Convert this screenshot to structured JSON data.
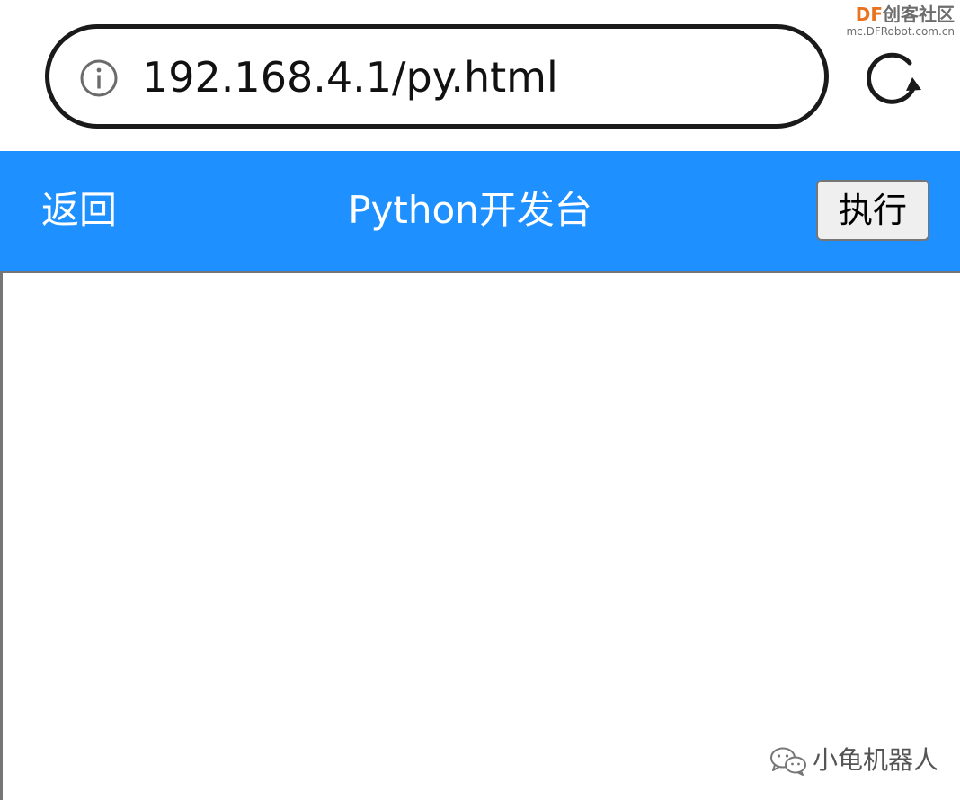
{
  "browser": {
    "url": "192.168.4.1/py.html",
    "info_icon": "info-icon",
    "reload_icon": "reload-icon"
  },
  "watermark_top": {
    "brand_df": "DF",
    "brand_cn": "创客社区",
    "site": "mc.DFRobot.com.cn"
  },
  "header": {
    "back_label": "返回",
    "title": "Python开发台",
    "run_label": "执行",
    "color": "#1e90ff"
  },
  "editor": {
    "value": ""
  },
  "watermark_bottom": {
    "icon": "wechat-icon",
    "label": "小龟机器人"
  }
}
